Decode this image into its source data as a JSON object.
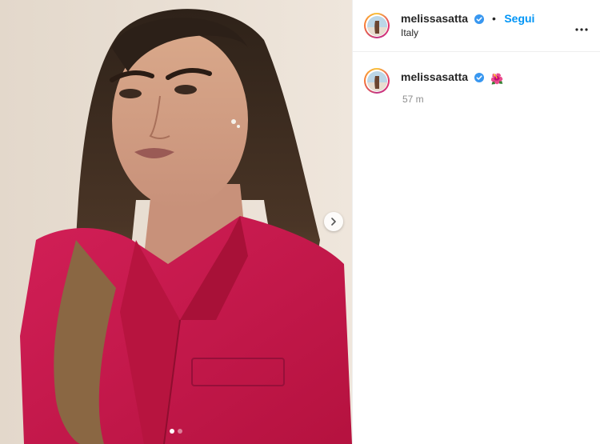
{
  "post": {
    "image_alt": "Woman with long wavy hair wearing a pink blazer",
    "carousel": {
      "total": 2,
      "current": 1
    }
  },
  "header": {
    "username": "melissasatta",
    "separator": "•",
    "follow_label": "Segui",
    "location": "Italy"
  },
  "caption": {
    "username": "melissasatta",
    "emoji": "🌺",
    "timestamp": "57 m"
  },
  "colors": {
    "accent": "#0095f6",
    "blazer": "#c8194e",
    "verified": "#3897f0"
  },
  "icons": [
    "verified-icon",
    "more-options-icon",
    "chevron-right-icon",
    "hibiscus-icon"
  ]
}
